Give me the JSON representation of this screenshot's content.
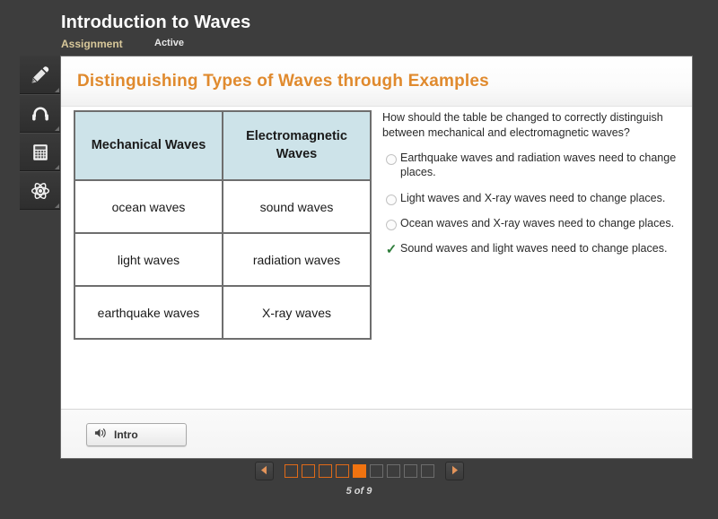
{
  "header": {
    "title": "Introduction to Waves",
    "assignment_label": "Assignment",
    "status_label": "Active"
  },
  "toolrail": {
    "items": [
      {
        "icon": "pencil-icon",
        "name": "highlighter-tool"
      },
      {
        "icon": "headphones-icon",
        "name": "audio-tool"
      },
      {
        "icon": "calculator-icon",
        "name": "calculator-tool"
      },
      {
        "icon": "atom-icon",
        "name": "science-reference-tool"
      }
    ]
  },
  "lesson": {
    "title": "Distinguishing Types of Waves through Examples"
  },
  "table": {
    "headers": [
      "Mechanical Waves",
      "Electromagnetic Waves"
    ],
    "rows": [
      [
        "ocean waves",
        "sound waves"
      ],
      [
        "light waves",
        "radiation waves"
      ],
      [
        "earthquake waves",
        "X-ray waves"
      ]
    ]
  },
  "question": {
    "text": "How should the table be changed to correctly distinguish between mechanical and electromagnetic waves?",
    "options": [
      {
        "text": "Earthquake waves and radiation waves need to change places.",
        "state": "unselected"
      },
      {
        "text": "Light waves and X-ray waves need to change places.",
        "state": "unselected"
      },
      {
        "text": "Ocean waves and X-ray waves need to change places.",
        "state": "unselected"
      },
      {
        "text": "Sound waves and light waves need to change places.",
        "state": "correct"
      }
    ]
  },
  "footer": {
    "audio_button_label": "Intro",
    "audio_icon": "speaker-icon"
  },
  "pager": {
    "prev_icon": "triangle-left-icon",
    "next_icon": "triangle-right-icon",
    "total": 9,
    "current": 5,
    "label": "5 of 9",
    "dot_states": [
      "visited",
      "visited",
      "visited",
      "visited",
      "current",
      "upcoming",
      "upcoming",
      "upcoming",
      "upcoming"
    ]
  },
  "colors": {
    "accent_orange": "#f07310",
    "title_orange": "#e08a2e",
    "table_header_blue": "#cde3e9",
    "correct_green": "#2e7d3a",
    "chrome_dark": "#3d3d3d"
  }
}
